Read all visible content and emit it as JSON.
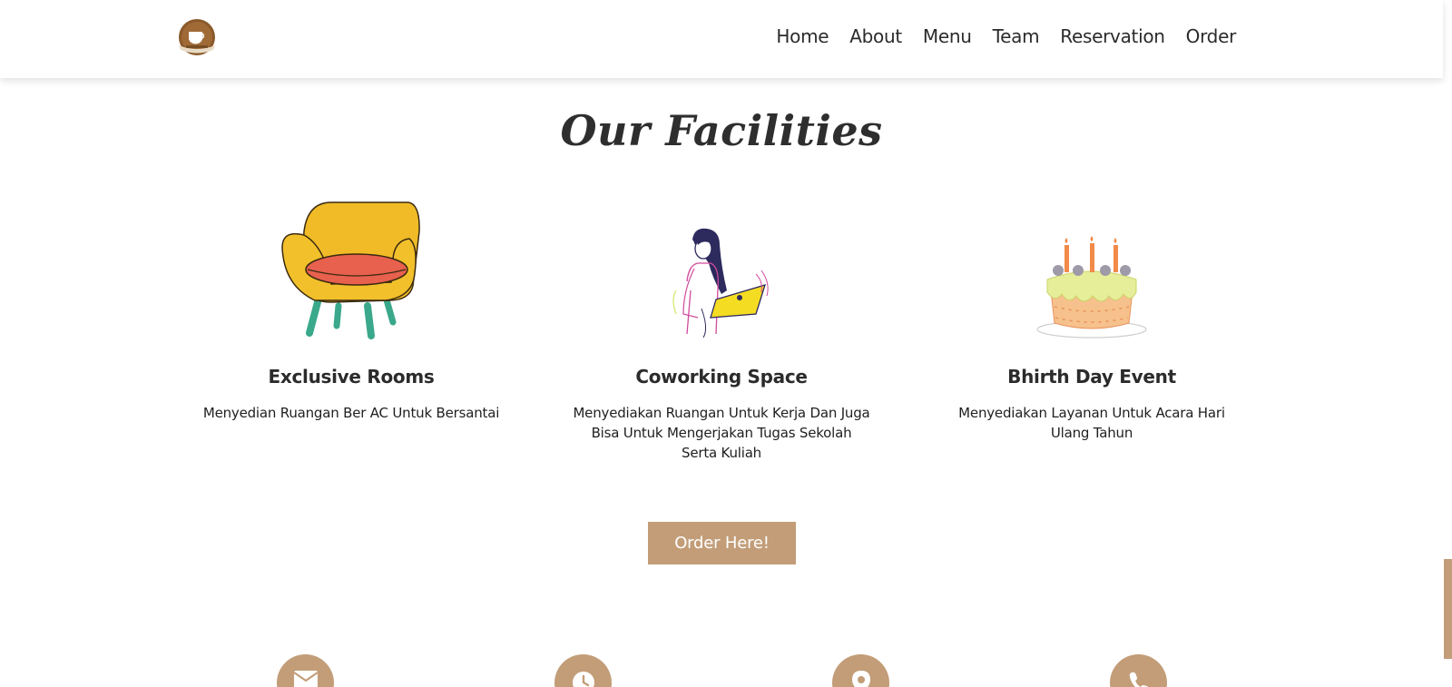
{
  "brand": {
    "logo_icon": "coffee-cup-logo-icon"
  },
  "nav": {
    "items": [
      {
        "label": "Home"
      },
      {
        "label": "About"
      },
      {
        "label": "Menu"
      },
      {
        "label": "Team"
      },
      {
        "label": "Reservation"
      },
      {
        "label": "Order"
      }
    ]
  },
  "facilities": {
    "title": "Our Facilities",
    "items": [
      {
        "icon": "armchair-icon",
        "title": "Exclusive Rooms",
        "desc": "Menyedian Ruangan Ber AC Untuk Bersantai"
      },
      {
        "icon": "woman-laptop-icon",
        "title": "Coworking Space",
        "desc": "Menyediakan Ruangan Untuk Kerja Dan Juga Bisa Untuk Mengerjakan Tugas Sekolah Serta Kuliah"
      },
      {
        "icon": "birthday-cake-icon",
        "title": "Bhirth Day Event",
        "desc": "Menyediakan Layanan Untuk Acara Hari Ulang Tahun"
      }
    ],
    "cta_label": "Order Here!"
  },
  "contact_icons": [
    "envelope-icon",
    "clock-icon",
    "map-pin-icon",
    "phone-icon"
  ],
  "colors": {
    "accent": "#c29d78",
    "text": "#2b2b2b",
    "background": "#ffffff"
  }
}
